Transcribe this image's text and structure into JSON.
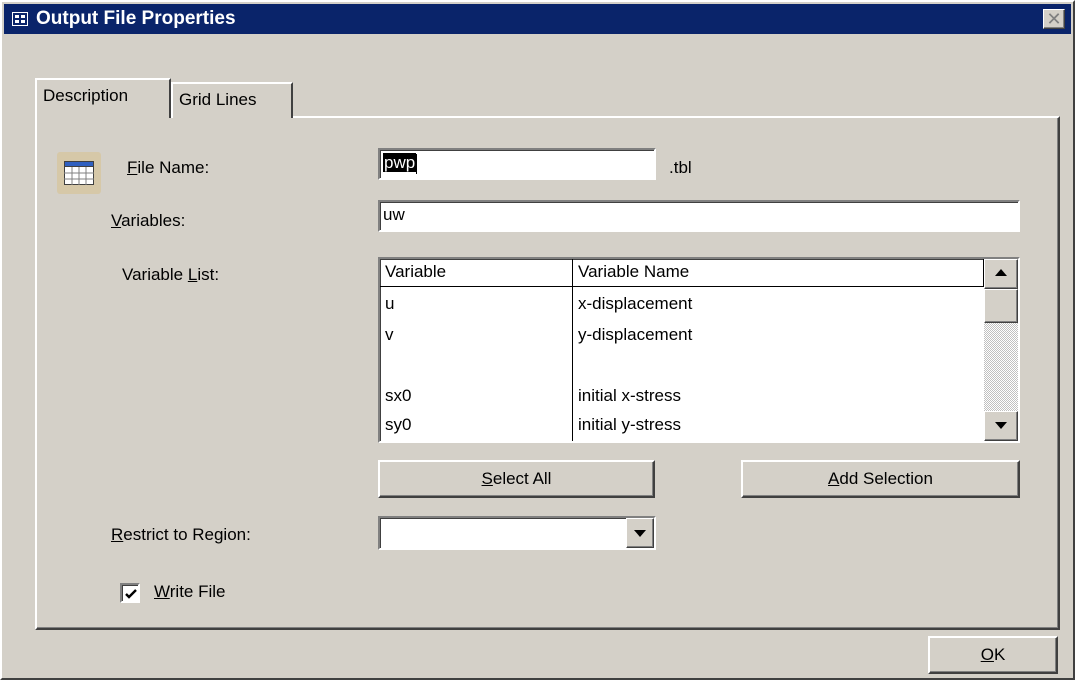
{
  "window": {
    "title": "Output File Properties"
  },
  "tabs": [
    {
      "label": "Description",
      "active": true
    },
    {
      "label": "Grid Lines",
      "active": false
    }
  ],
  "file_name": {
    "underline_char": "F",
    "label_rest": "ile Name:",
    "value": "pwp",
    "extension": ".tbl"
  },
  "variables": {
    "underline_char": "V",
    "label_rest": "ariables:",
    "value": "uw"
  },
  "variable_list": {
    "label_before": "Variable ",
    "underline_char": "L",
    "label_after": "ist:",
    "columns": [
      "Variable",
      "Variable Name"
    ],
    "rows": [
      {
        "variable": "u",
        "name": "x-displacement"
      },
      {
        "variable": "v",
        "name": "y-displacement"
      },
      {
        "variable": "",
        "name": ""
      },
      {
        "variable": "sx0",
        "name": "initial x-stress"
      },
      {
        "variable": "sy0",
        "name": "initial y-stress"
      }
    ]
  },
  "buttons": {
    "select_all": {
      "underline_char": "S",
      "rest": "elect All"
    },
    "add_selection": {
      "underline_char": "A",
      "rest": "dd Selection"
    },
    "ok": {
      "underline_char": "O",
      "rest": "K"
    }
  },
  "restrict_region": {
    "underline_char": "R",
    "label_rest": "estrict to Region:",
    "value": ""
  },
  "write_file": {
    "underline_char": "W",
    "label_rest": "rite File",
    "checked": true
  },
  "colors": {
    "titlebar": "#0a246a",
    "face": "#d4d0c8"
  },
  "icons": [
    "app-icon",
    "close-icon",
    "table-icon",
    "scroll-up-icon",
    "scroll-down-icon",
    "dropdown-arrow-icon",
    "checkmark-icon"
  ]
}
